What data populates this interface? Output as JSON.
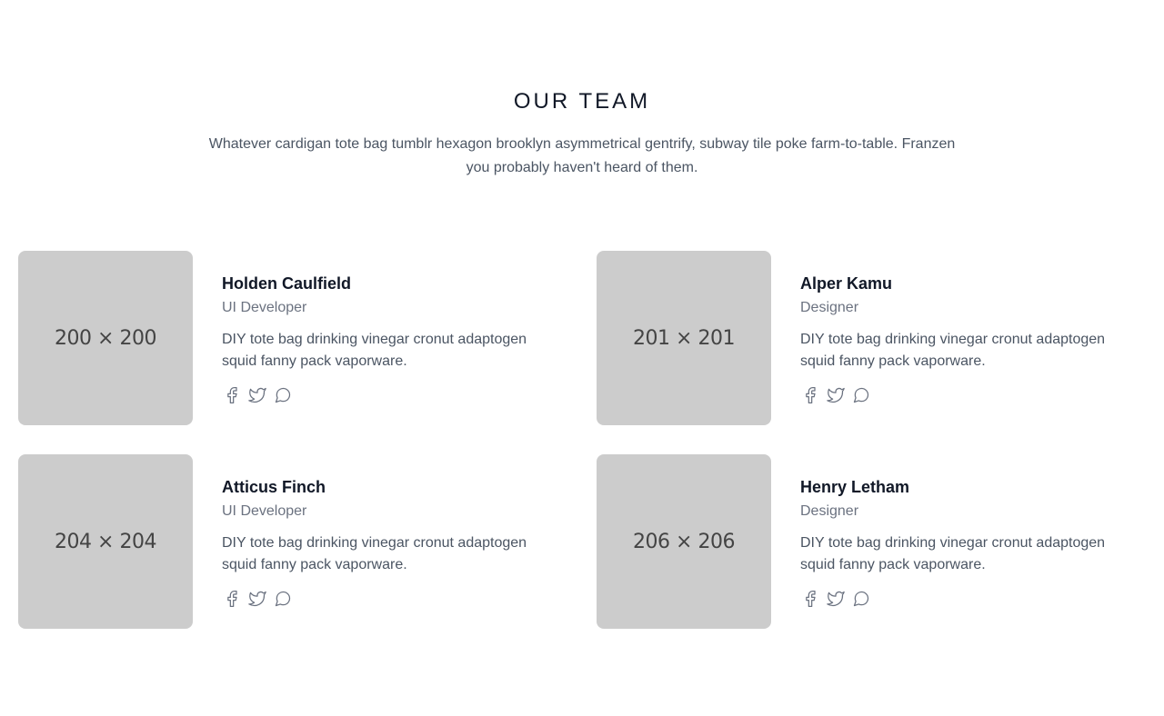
{
  "section": {
    "title": "OUR TEAM",
    "subtitle": "Whatever cardigan tote bag tumblr hexagon brooklyn asymmetrical gentrify, subway tile poke farm-to-table. Franzen you probably haven't heard of them."
  },
  "members": [
    {
      "photo_placeholder": "200 × 200",
      "name": "Holden Caulfield",
      "role": "UI Developer",
      "bio": "DIY tote bag drinking vinegar cronut adaptogen squid fanny pack vaporware."
    },
    {
      "photo_placeholder": "201 × 201",
      "name": "Alper Kamu",
      "role": "Designer",
      "bio": "DIY tote bag drinking vinegar cronut adaptogen squid fanny pack vaporware."
    },
    {
      "photo_placeholder": "204 × 204",
      "name": "Atticus Finch",
      "role": "UI Developer",
      "bio": "DIY tote bag drinking vinegar cronut adaptogen squid fanny pack vaporware."
    },
    {
      "photo_placeholder": "206 × 206",
      "name": "Henry Letham",
      "role": "Designer",
      "bio": "DIY tote bag drinking vinegar cronut adaptogen squid fanny pack vaporware."
    }
  ],
  "social_icons": [
    "facebook-icon",
    "twitter-icon",
    "chat-icon"
  ],
  "colors": {
    "background": "#ffffff",
    "photo_placeholder": "#cccccc",
    "heading": "#111827",
    "text": "#4b5563",
    "muted": "#6b7280"
  }
}
